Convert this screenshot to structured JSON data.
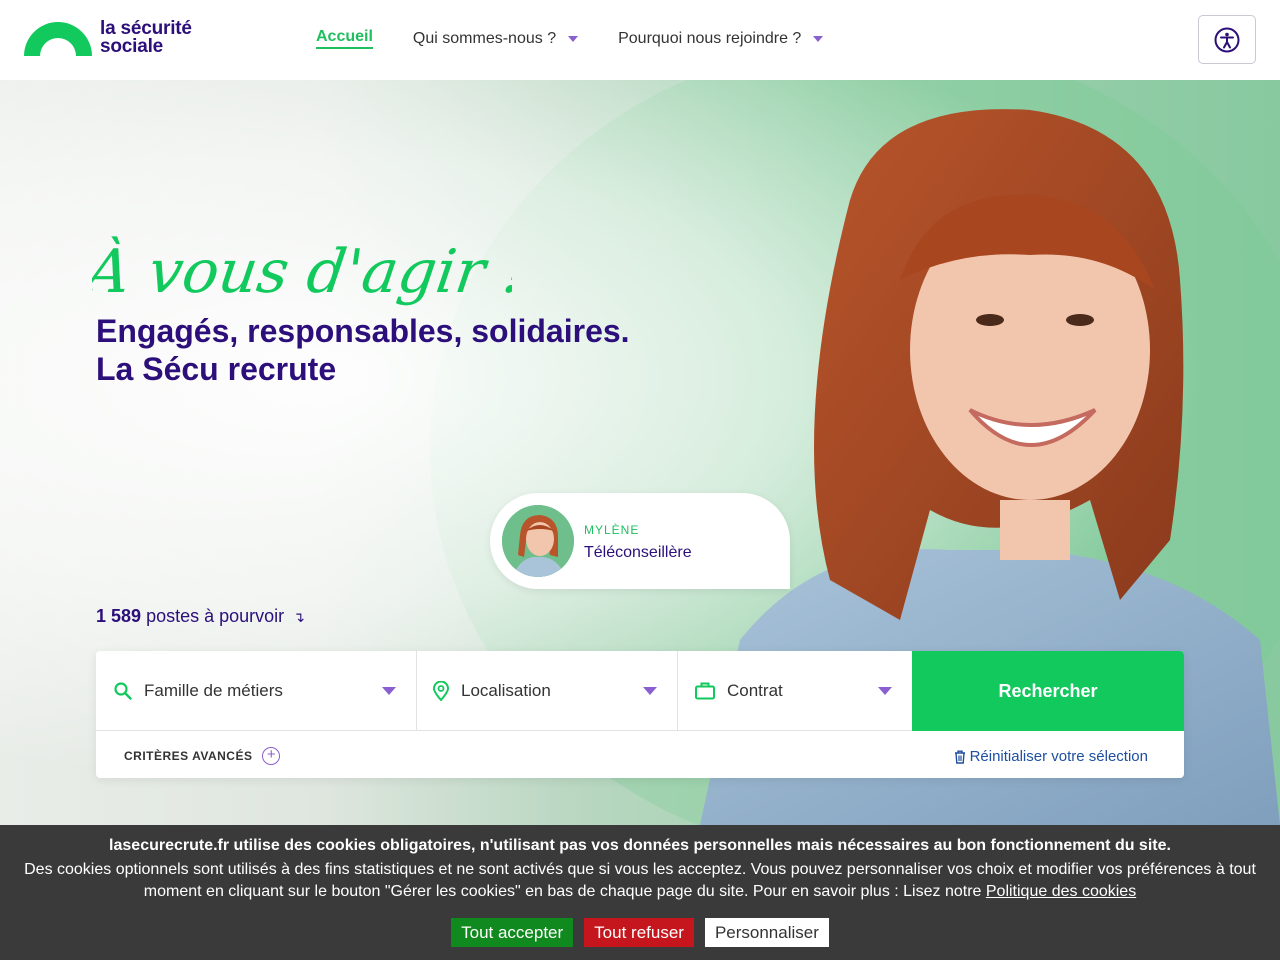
{
  "header": {
    "logo": {
      "line1": "la sécurité",
      "line2": "sociale"
    },
    "nav": [
      {
        "label": "Accueil",
        "active": true,
        "dropdown": false
      },
      {
        "label": "Qui sommes-nous ?",
        "active": false,
        "dropdown": true
      },
      {
        "label": "Pourquoi nous rejoindre ?",
        "active": false,
        "dropdown": true
      }
    ],
    "accessibility_icon": "accessibility-icon"
  },
  "hero": {
    "tagline": "À vous d'agir !",
    "subtitle_line1": "Engagés, responsables, solidaires.",
    "subtitle_line2": "La Sécu recrute",
    "profile": {
      "name": "MYLÈNE",
      "role": "Téléconseillère"
    },
    "postes_count": "1 589",
    "postes_label": "postes à pourvoir",
    "postes_arrow": "↴"
  },
  "search": {
    "fields": [
      {
        "label": "Famille de métiers",
        "icon": "search-icon"
      },
      {
        "label": "Localisation",
        "icon": "location-pin-icon"
      },
      {
        "label": "Contrat",
        "icon": "briefcase-icon"
      }
    ],
    "submit_label": "Rechercher",
    "advanced_label": "CRITÈRES AVANCÉS",
    "reset_label": "Réinitialiser votre sélection"
  },
  "cookie": {
    "title": "lasecurecrute.fr utilise des cookies obligatoires, n'utilisant pas vos données personnelles mais nécessaires au bon fonctionnement du site.",
    "text": "Des cookies optionnels sont utilisés à des fins statistiques et ne sont activés que si vous les acceptez. Vous pouvez personnaliser vos choix et modifier vos préférences à tout moment en cliquant sur le bouton \"Gérer les cookies\" en bas de chaque page du site. Pour en savoir plus : Lisez notre",
    "link": "Politique des cookies",
    "accept": "Tout accepter",
    "refuse": "Tout refuser",
    "customize": "Personnaliser"
  },
  "colors": {
    "brand_purple": "#2c0f7a",
    "brand_green": "#1fbf5f",
    "search_button": "#12c95e",
    "accept": "#108a1e",
    "refuse": "#c4161c"
  }
}
